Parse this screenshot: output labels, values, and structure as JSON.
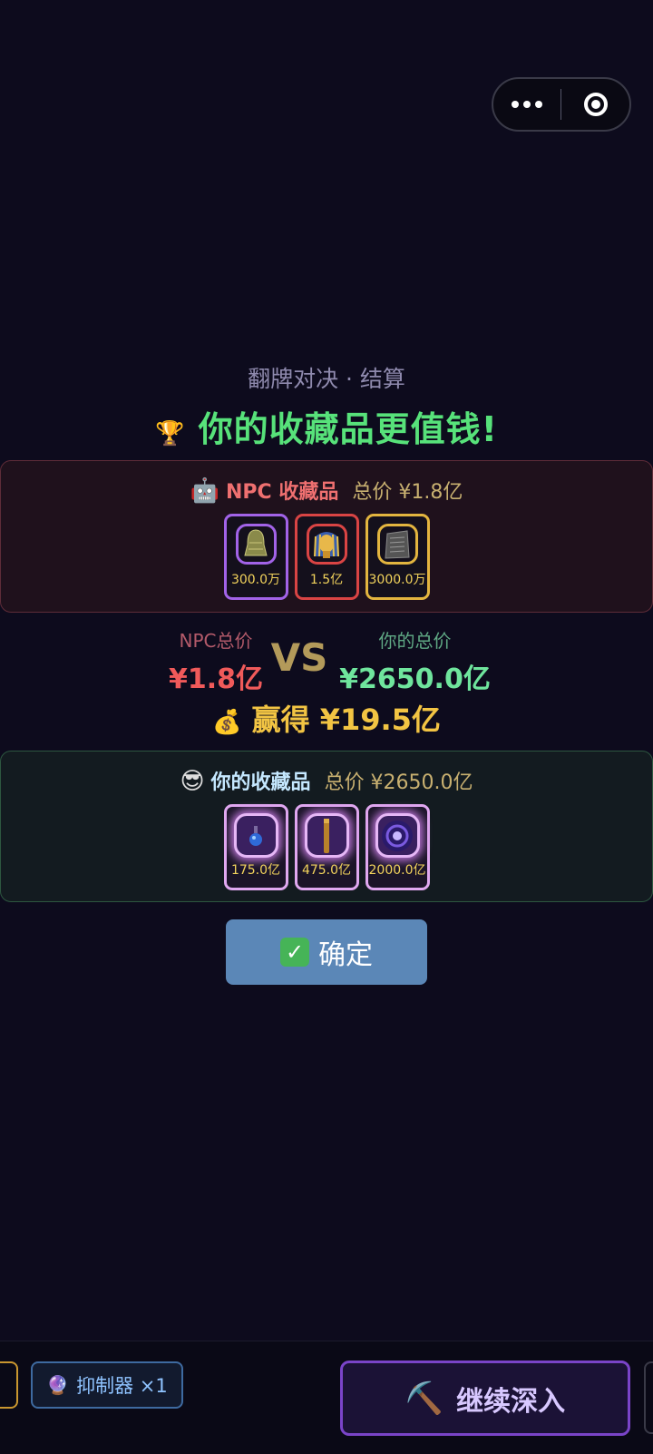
{
  "header": {
    "subtitle": "翻牌对决 · 结算",
    "headline": "你的收藏品更值钱!"
  },
  "npc_panel": {
    "title": "NPC 收藏品",
    "total": "总价 ¥1.8亿",
    "cards": [
      {
        "value": "300.0万",
        "item_icon": "bell-icon",
        "frame": "purple"
      },
      {
        "value": "1.5亿",
        "item_icon": "golden-mask-icon",
        "frame": "red"
      },
      {
        "value": "3000.0万",
        "item_icon": "stone-tablet-icon",
        "frame": "gold"
      }
    ]
  },
  "comparison": {
    "npc_label": "NPC总价",
    "npc_value": "¥1.8亿",
    "vs": "VS",
    "my_label": "你的总价",
    "my_value": "¥2650.0亿",
    "win_text": "赢得 ¥19.5亿"
  },
  "my_panel": {
    "title": "你的收藏品",
    "total": "总价 ¥2650.0亿",
    "cards": [
      {
        "value": "175.0亿",
        "item_icon": "potion-icon",
        "frame": "pink"
      },
      {
        "value": "475.0亿",
        "item_icon": "staff-icon",
        "frame": "pink"
      },
      {
        "value": "2000.0亿",
        "item_icon": "vortex-orb-icon",
        "frame": "pink"
      }
    ]
  },
  "confirm_button": {
    "label": "确定"
  },
  "bottom_bar": {
    "item_chip": "抑制器 ×1",
    "continue_button": "继续深入"
  },
  "colors": {
    "background": "#0d0b1d",
    "headline": "#57e27a",
    "npc_accent": "#ef7070",
    "my_accent": "#6fe59d",
    "win": "#f2c443",
    "confirm_button": "#5b87b7",
    "continue_border": "#7a44c8"
  }
}
